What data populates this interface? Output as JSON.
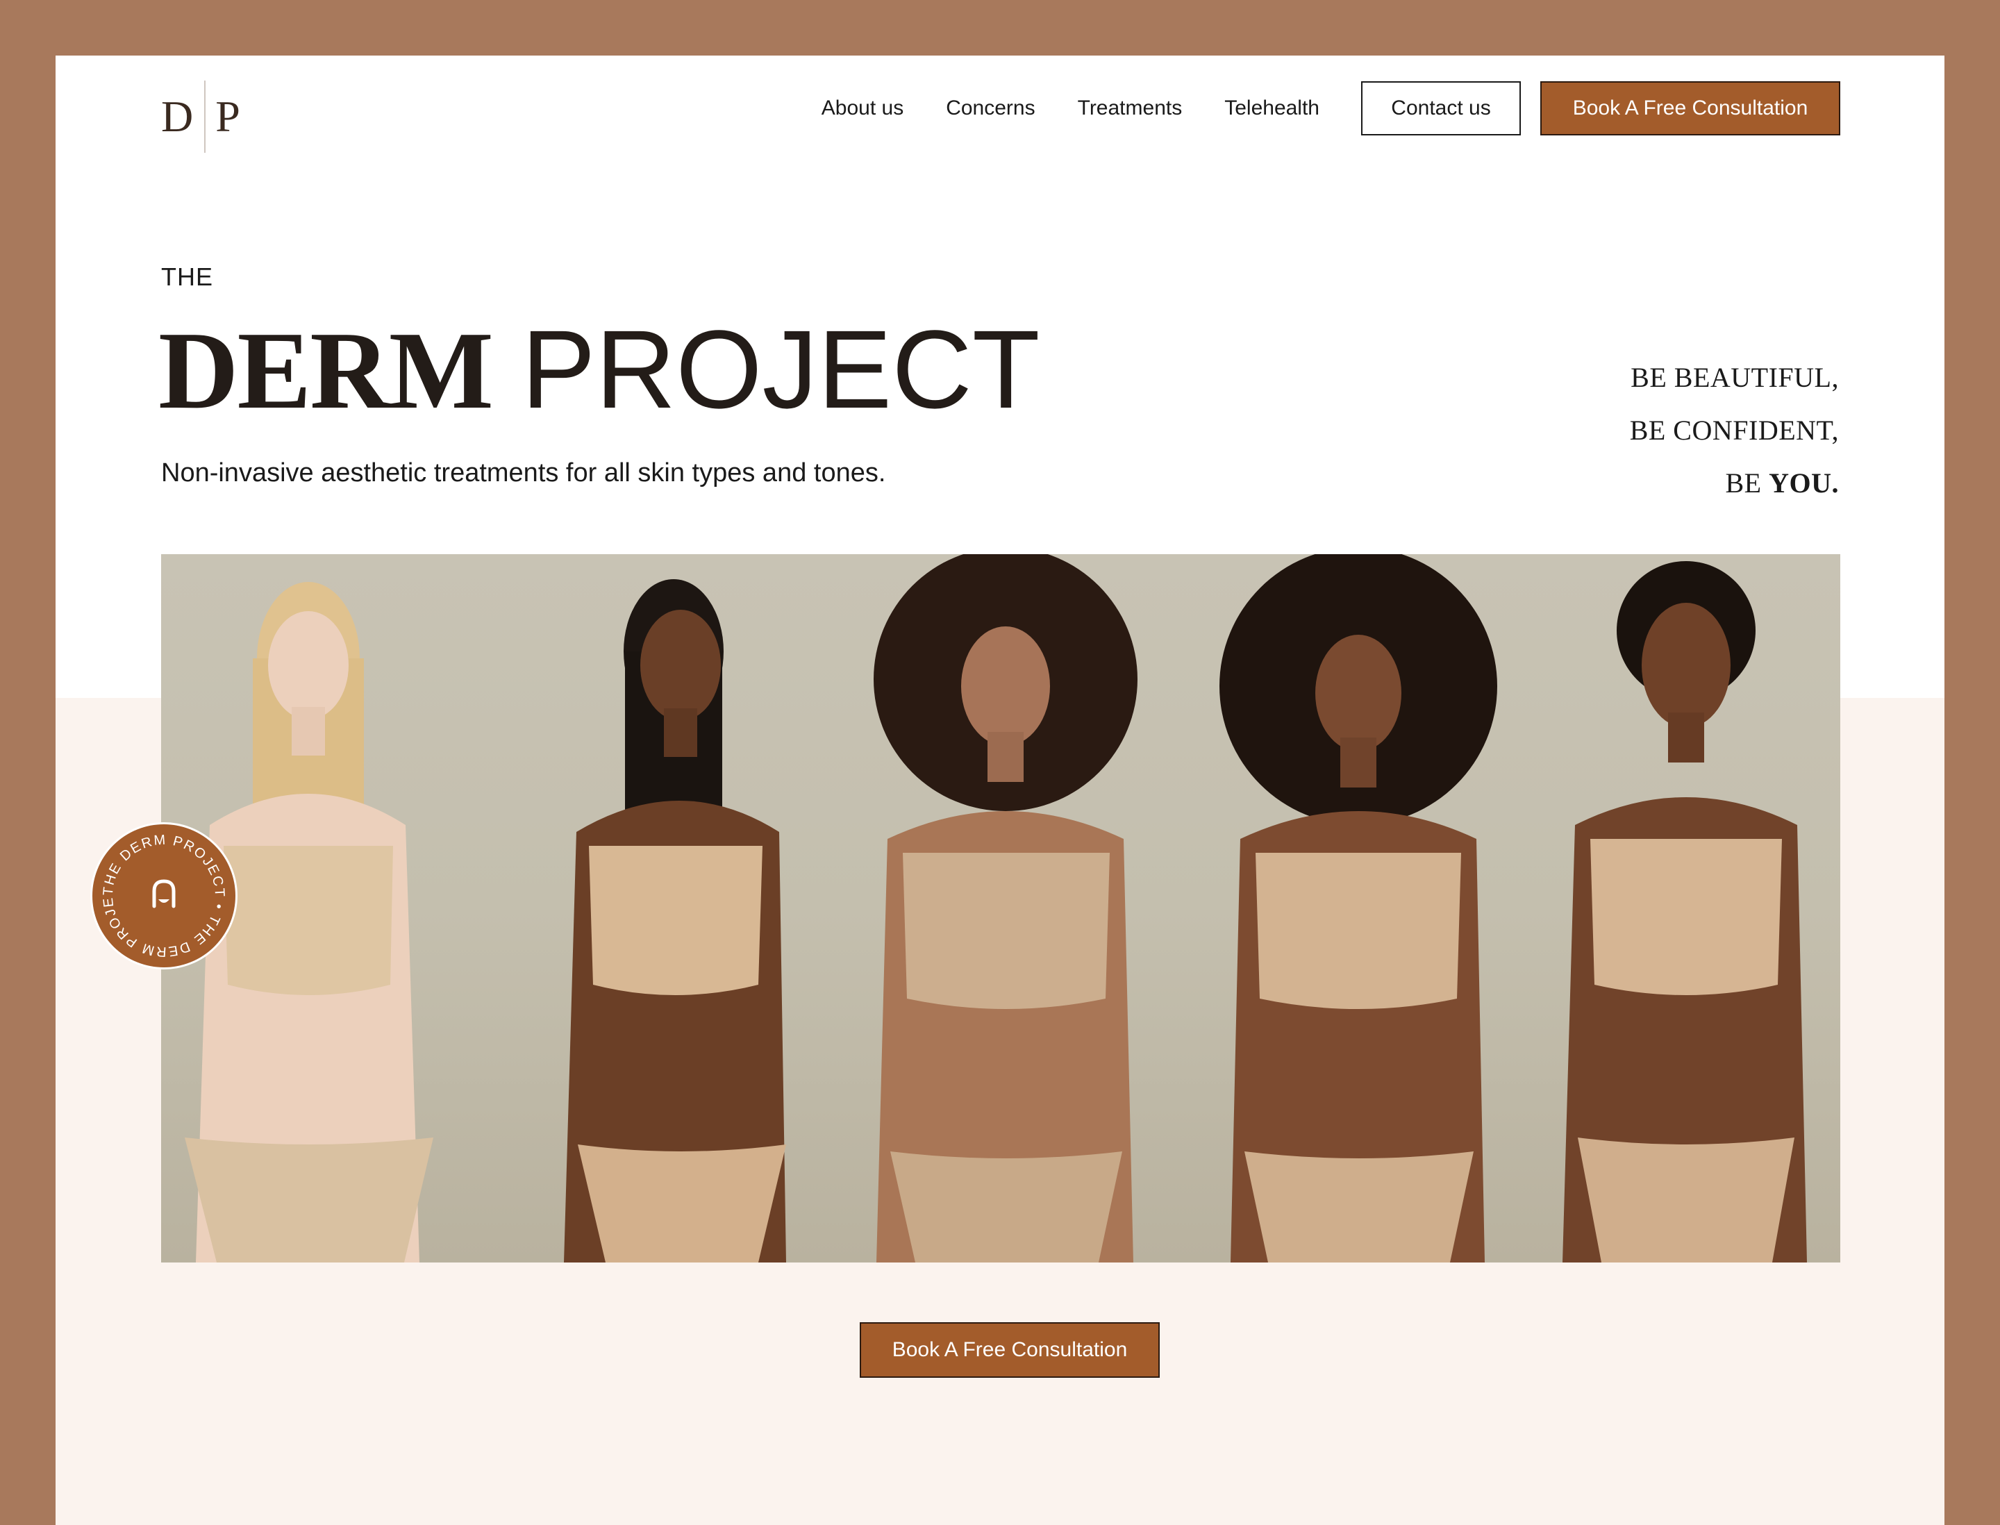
{
  "brand": {
    "logo_left": "D",
    "logo_right": "P"
  },
  "nav": {
    "links": [
      "About us",
      "Concerns",
      "Treatments",
      "Telehealth"
    ],
    "contact_label": "Contact us",
    "book_label": "Book A Free Consultation"
  },
  "hero": {
    "kicker": "THE",
    "title_bold": "DERM",
    "title_light": "PROJECT",
    "subtitle": "Non-invasive aesthetic treatments for all skin types and tones.",
    "tagline_line1": "BE BEAUTIFUL,",
    "tagline_line2": "BE CONFIDENT,",
    "tagline_line3_prefix": "BE",
    "tagline_line3_emphasis": "YOU."
  },
  "image": {
    "alt": "Five women in nude-toned underwear standing side by side"
  },
  "badge": {
    "ring_text": "THE DERM PROJECT • THE DERM PROJECT •",
    "icon": "face-icon"
  },
  "cta": {
    "label": "Book A Free Consultation"
  },
  "colors": {
    "frame": "#a8795c",
    "accent": "#a35c2b",
    "band": "#fbf3ee",
    "text": "#1a1a1a"
  }
}
